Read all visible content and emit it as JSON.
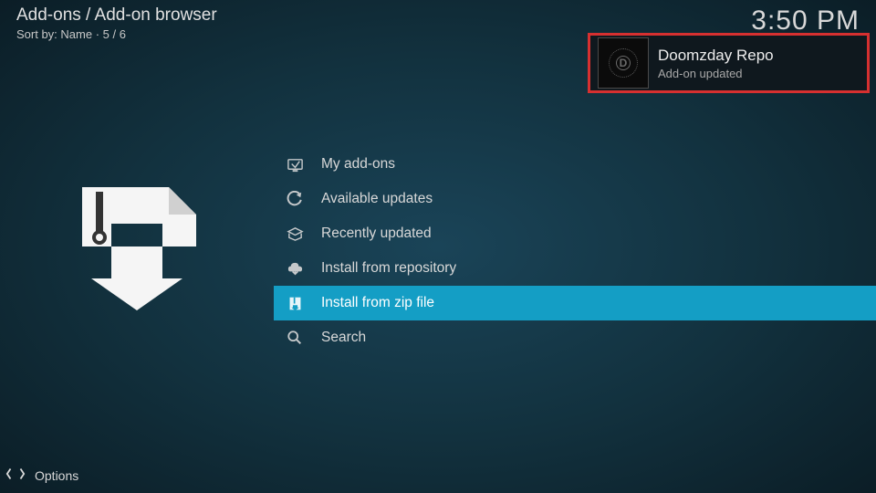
{
  "header": {
    "breadcrumb": "Add-ons / Add-on browser",
    "sort_label": "Sort by: Name  ·  5 / 6",
    "clock": "3:50 PM"
  },
  "menu": {
    "items": [
      {
        "icon": "my-addons-icon",
        "label": "My add-ons"
      },
      {
        "icon": "updates-icon",
        "label": "Available updates"
      },
      {
        "icon": "recent-icon",
        "label": "Recently updated"
      },
      {
        "icon": "repo-icon",
        "label": "Install from repository"
      },
      {
        "icon": "zip-icon",
        "label": "Install from zip file"
      },
      {
        "icon": "search-icon",
        "label": "Search"
      }
    ],
    "selected_index": 4
  },
  "notification": {
    "title": "Doomzday Repo",
    "subtitle": "Add-on updated",
    "thumbLetter": "D"
  },
  "footer": {
    "options_label": "Options"
  }
}
